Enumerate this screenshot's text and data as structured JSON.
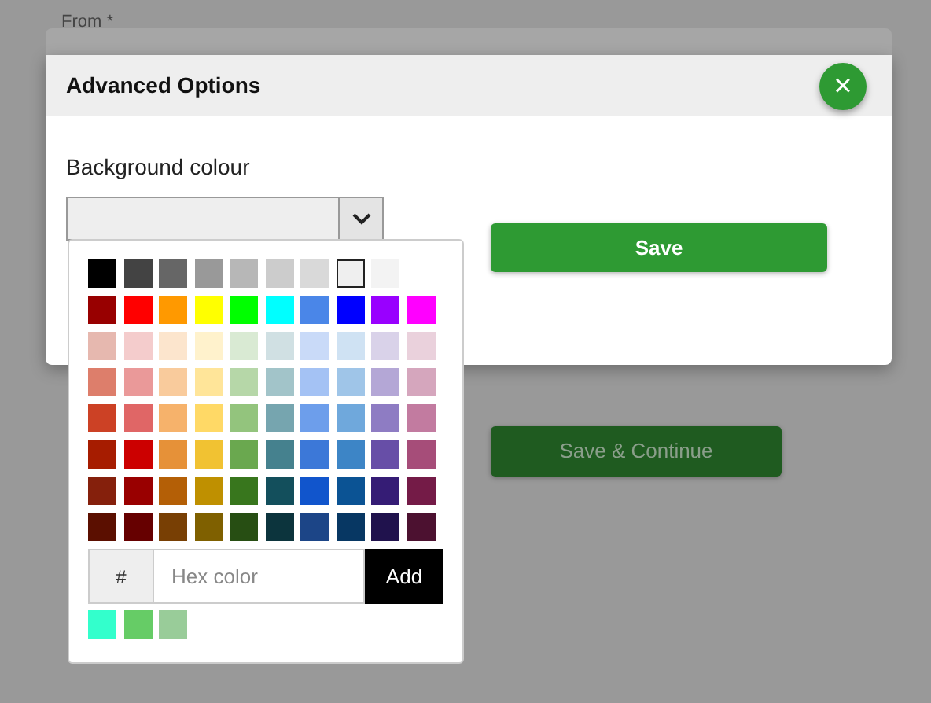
{
  "background_form": {
    "field_label": "From *",
    "button": "Save & Continue"
  },
  "modal": {
    "title": "Advanced Options",
    "close": "×",
    "field_label": "Background colour",
    "save": "Save"
  },
  "picker": {
    "rows": [
      {
        "swatches": [
          {
            "color": "#000000",
            "selected": false
          },
          {
            "color": "#434343",
            "selected": false
          },
          {
            "color": "#666666",
            "selected": false
          },
          {
            "color": "#999999",
            "selected": false
          },
          {
            "color": "#b7b7b7",
            "selected": false
          },
          {
            "color": "#cccccc",
            "selected": false
          },
          {
            "color": "#d9d9d9",
            "selected": false
          },
          {
            "color": "#efefef",
            "selected": true
          },
          {
            "color": "#f3f3f3",
            "selected": false
          }
        ]
      },
      {
        "swatches": [
          {
            "color": "#980000",
            "selected": false
          },
          {
            "color": "#ff0000",
            "selected": false
          },
          {
            "color": "#ff9900",
            "selected": false
          },
          {
            "color": "#ffff00",
            "selected": false
          },
          {
            "color": "#00ff00",
            "selected": false
          },
          {
            "color": "#00ffff",
            "selected": false
          },
          {
            "color": "#4a86e8",
            "selected": false
          },
          {
            "color": "#0000ff",
            "selected": false
          },
          {
            "color": "#9900ff",
            "selected": false
          },
          {
            "color": "#ff00ff",
            "selected": false
          }
        ]
      },
      {
        "swatches": [
          {
            "color": "#e6b8af",
            "selected": false
          },
          {
            "color": "#f4cccc",
            "selected": false
          },
          {
            "color": "#fce5cd",
            "selected": false
          },
          {
            "color": "#fff2cc",
            "selected": false
          },
          {
            "color": "#d9ead3",
            "selected": false
          },
          {
            "color": "#d0e0e3",
            "selected": false
          },
          {
            "color": "#c9daf8",
            "selected": false
          },
          {
            "color": "#cfe2f3",
            "selected": false
          },
          {
            "color": "#d9d2e9",
            "selected": false
          },
          {
            "color": "#ead1dc",
            "selected": false
          }
        ]
      },
      {
        "swatches": [
          {
            "color": "#dd7e6b",
            "selected": false
          },
          {
            "color": "#ea9999",
            "selected": false
          },
          {
            "color": "#f9cb9c",
            "selected": false
          },
          {
            "color": "#ffe599",
            "selected": false
          },
          {
            "color": "#b6d7a8",
            "selected": false
          },
          {
            "color": "#a2c4c9",
            "selected": false
          },
          {
            "color": "#a4c2f4",
            "selected": false
          },
          {
            "color": "#9fc5e8",
            "selected": false
          },
          {
            "color": "#b4a7d6",
            "selected": false
          },
          {
            "color": "#d5a6bd",
            "selected": false
          }
        ]
      },
      {
        "swatches": [
          {
            "color": "#cc4125",
            "selected": false
          },
          {
            "color": "#e06666",
            "selected": false
          },
          {
            "color": "#f6b26b",
            "selected": false
          },
          {
            "color": "#ffd966",
            "selected": false
          },
          {
            "color": "#93c47d",
            "selected": false
          },
          {
            "color": "#76a5af",
            "selected": false
          },
          {
            "color": "#6d9eeb",
            "selected": false
          },
          {
            "color": "#6fa8dc",
            "selected": false
          },
          {
            "color": "#8e7cc3",
            "selected": false
          },
          {
            "color": "#c27ba0",
            "selected": false
          }
        ]
      },
      {
        "swatches": [
          {
            "color": "#a61c00",
            "selected": false
          },
          {
            "color": "#cc0000",
            "selected": false
          },
          {
            "color": "#e69138",
            "selected": false
          },
          {
            "color": "#f1c232",
            "selected": false
          },
          {
            "color": "#6aa84f",
            "selected": false
          },
          {
            "color": "#45818e",
            "selected": false
          },
          {
            "color": "#3c78d8",
            "selected": false
          },
          {
            "color": "#3d85c6",
            "selected": false
          },
          {
            "color": "#674ea7",
            "selected": false
          },
          {
            "color": "#a64d79",
            "selected": false
          }
        ]
      },
      {
        "swatches": [
          {
            "color": "#85200c",
            "selected": false
          },
          {
            "color": "#990000",
            "selected": false
          },
          {
            "color": "#b45f06",
            "selected": false
          },
          {
            "color": "#bf9000",
            "selected": false
          },
          {
            "color": "#38761d",
            "selected": false
          },
          {
            "color": "#134f5c",
            "selected": false
          },
          {
            "color": "#1155cc",
            "selected": false
          },
          {
            "color": "#0b5394",
            "selected": false
          },
          {
            "color": "#351c75",
            "selected": false
          },
          {
            "color": "#741b47",
            "selected": false
          }
        ]
      },
      {
        "swatches": [
          {
            "color": "#5b0f00",
            "selected": false
          },
          {
            "color": "#660000",
            "selected": false
          },
          {
            "color": "#783f04",
            "selected": false
          },
          {
            "color": "#7f6000",
            "selected": false
          },
          {
            "color": "#274e13",
            "selected": false
          },
          {
            "color": "#0c343d",
            "selected": false
          },
          {
            "color": "#1c4587",
            "selected": false
          },
          {
            "color": "#073763",
            "selected": false
          },
          {
            "color": "#20124d",
            "selected": false
          },
          {
            "color": "#4c1130",
            "selected": false
          }
        ]
      }
    ],
    "hex_prefix": "#",
    "hex_placeholder": "Hex color",
    "add": "Add",
    "custom": [
      {
        "color": "#33ffcc",
        "selected": false
      },
      {
        "color": "#66cc66",
        "selected": false
      },
      {
        "color": "#99cc99",
        "selected": false
      }
    ]
  }
}
